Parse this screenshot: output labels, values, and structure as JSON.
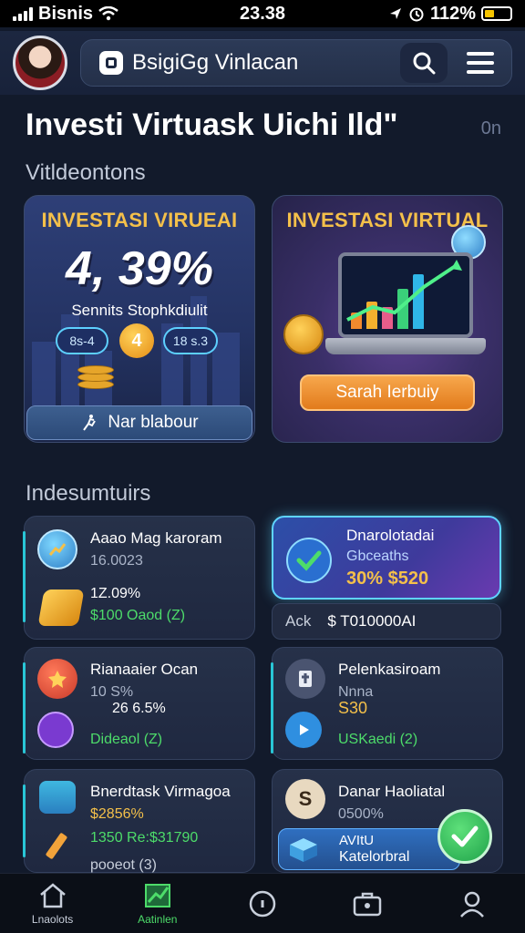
{
  "status_bar": {
    "carrier": "Bisnis",
    "time": "23.38",
    "battery": "112%"
  },
  "header": {
    "app_name": "BsigiGg Vinlacan",
    "search_icon": "search-icon",
    "menu_icon": "hamburger-menu-icon"
  },
  "page": {
    "title": "Investi Virtuask Uichi Ild\"",
    "title_aside": "0n"
  },
  "sections": {
    "hero_label": "Vitldeontons",
    "list_label": "Indesumtuirs"
  },
  "hero_left": {
    "title": "INVESTASI VIRUEAI",
    "big_number": "4, 39%",
    "subtitle": "Sennits Stophkdiulit",
    "chip_left": "8s-4",
    "chip_mid": "4",
    "chip_right": "18 s.3",
    "button_label": "Nar blabour"
  },
  "hero_right": {
    "title": "INVESTASI VIRTUAL",
    "button_label": "Sarah Ierbuiy"
  },
  "cards": [
    {
      "title": "Aaao Mag karoram",
      "subtitle": "16.0023",
      "line1": "1Z.09%",
      "line2": "$100 Oaod (Z)",
      "accent": "#29c6d6"
    },
    {
      "title": "Dnarolotadai",
      "subtitle": "Gbceaths",
      "line1": "30% $520",
      "balance_label": "Ack",
      "balance_value": "$ T010000AI"
    },
    {
      "title": "Rianaaier Ocan",
      "subtitle": "10 S%",
      "line1": "26 6.5%",
      "line2": "Dideaol (Z)"
    },
    {
      "title": "Pelenkasiroam",
      "subtitle": "Nnna",
      "line1": "S30",
      "line2": "USKaedi (2)"
    },
    {
      "title": "Bnerdtask Virmagoa",
      "subtitle": "$2856%",
      "line1": "1350 Re:$31790",
      "line2": "pooeot (3)"
    },
    {
      "title": "Danar Haoliatal",
      "subtitle": "0500%",
      "line1": "AVItU",
      "line2": "Katelorbral"
    }
  ],
  "bottom_nav": [
    {
      "label": "Lnaolots",
      "icon": "home-icon",
      "active": false
    },
    {
      "label": "Aatinlen",
      "icon": "chart-icon",
      "active": true
    },
    {
      "label": "",
      "icon": "compass-icon",
      "active": false
    },
    {
      "label": "",
      "icon": "briefcase-icon",
      "active": false
    },
    {
      "label": "",
      "icon": "profile-icon",
      "active": false
    }
  ],
  "colors": {
    "background": "#121a2b",
    "accent_green": "#4ddc6a",
    "accent_gold": "#f4c04a",
    "accent_cyan": "#5fd4ff"
  }
}
